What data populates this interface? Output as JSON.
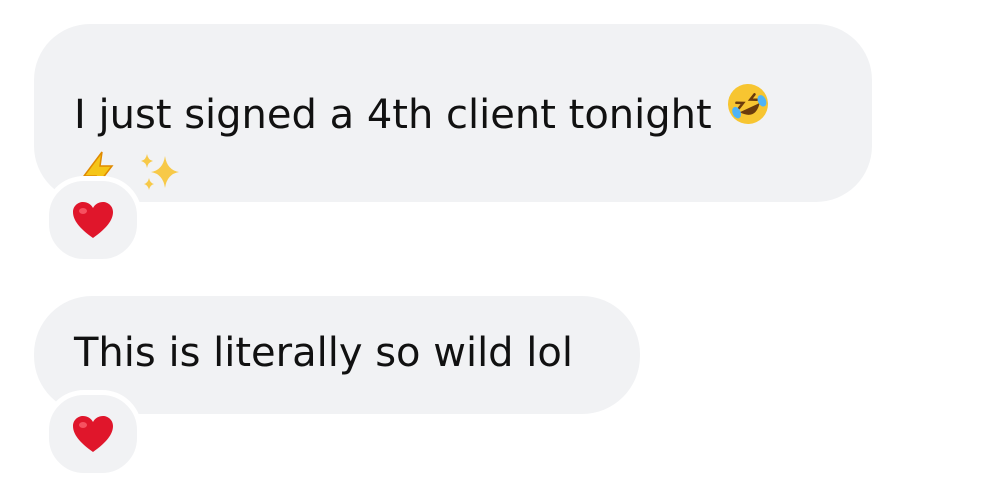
{
  "messages": [
    {
      "text": "I just signed a 4th client tonight",
      "reaction": "heart-reaction",
      "trailing_emoji": "rolling-on-floor-laughing-emoji",
      "extra_emojis": [
        "high-voltage-emoji",
        "sparkles-emoji"
      ]
    },
    {
      "text": "This is literally so wild lol",
      "reaction": "heart-reaction"
    }
  ],
  "colors": {
    "bubble": "#f1f2f4",
    "text": "#111111",
    "heart": "#e0162b",
    "laugh_face": "#f7c531",
    "bolt": "#f5c518",
    "sparkle": "#f7c948"
  }
}
